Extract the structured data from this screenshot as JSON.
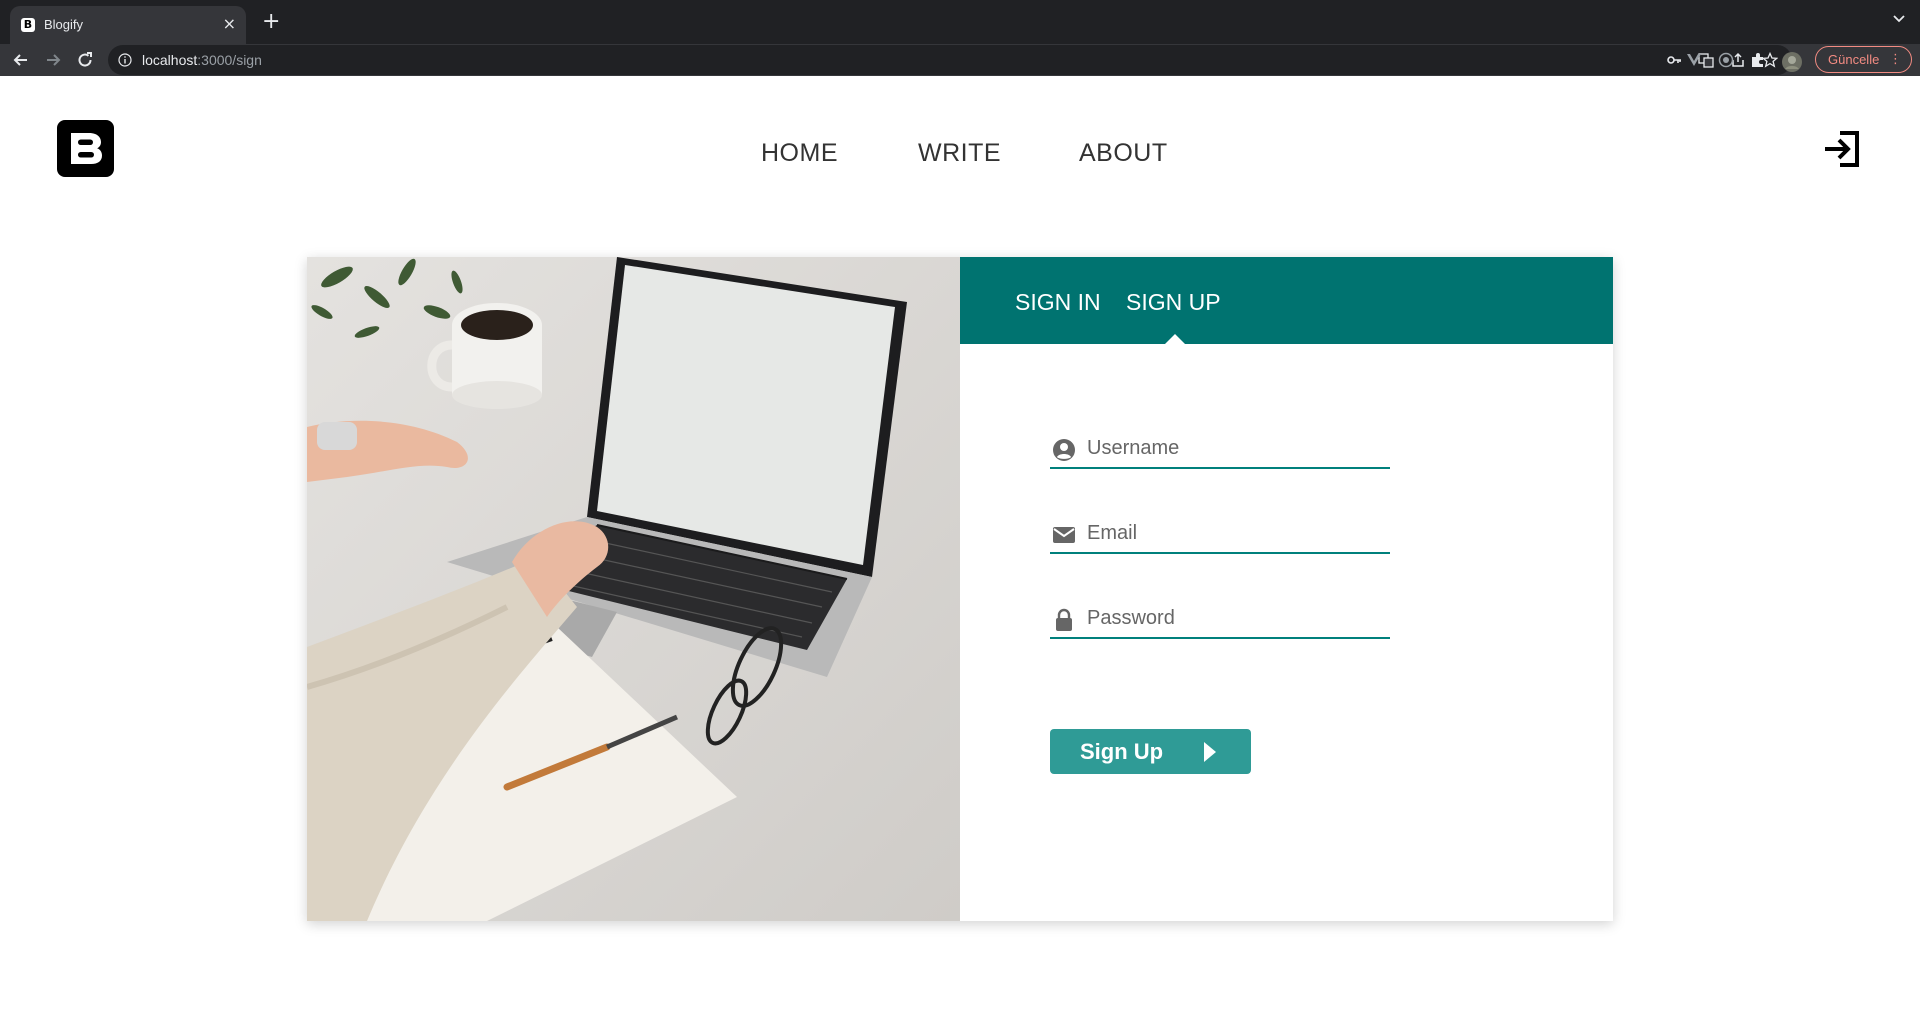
{
  "browser": {
    "tab_title": "Blogify",
    "favicon_letter": "B",
    "url_host": "localhost",
    "url_path": ":3000/sign",
    "update_label": "Güncelle",
    "update_dots": "⋮"
  },
  "header": {
    "nav": [
      {
        "label": "HOME"
      },
      {
        "label": "WRITE"
      },
      {
        "label": "ABOUT"
      }
    ]
  },
  "auth": {
    "tabs": [
      {
        "label": "SIGN IN",
        "active": false
      },
      {
        "label": "SIGN UP",
        "active": true
      }
    ],
    "fields": {
      "username": {
        "placeholder": "Username",
        "value": "",
        "icon": "user-circle-icon"
      },
      "email": {
        "placeholder": "Email",
        "value": "",
        "icon": "envelope-icon"
      },
      "password": {
        "placeholder": "Password",
        "value": "",
        "icon": "lock-icon"
      }
    },
    "submit_label": "Sign Up"
  },
  "colors": {
    "header_teal": "#007370",
    "button_teal": "#2f9b96",
    "underline_teal": "#00807c",
    "browser_dark": "#202124",
    "update_red": "#f28b82"
  }
}
